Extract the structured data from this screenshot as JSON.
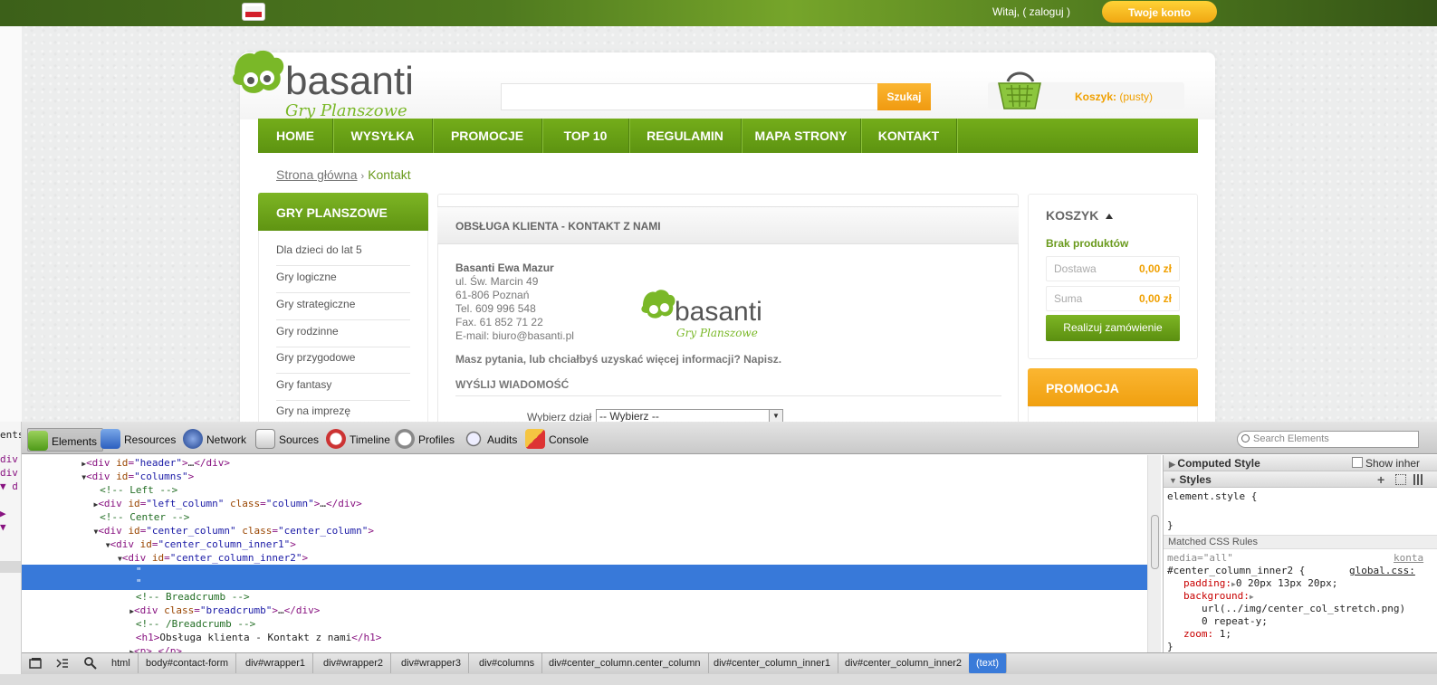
{
  "site": {
    "welcome": "Witaj, ( zaloguj )",
    "account_button": "Twoje konto",
    "logo_text": "basanti",
    "logo_tagline": "Gry Planszowe",
    "search_button": "Szukaj",
    "cart_label": "Koszyk:",
    "cart_status": "(pusty)",
    "nav": [
      "HOME",
      "WYSYŁKA",
      "PROMOCJE",
      "TOP 10",
      "REGULAMIN",
      "MAPA STRONY",
      "KONTAKT"
    ],
    "breadcrumb": {
      "home": "Strona główna",
      "sep": "›",
      "current": "Kontakt"
    },
    "categories_title": "GRY PLANSZOWE",
    "categories": [
      "Dla dzieci do lat 5",
      "Gry logiczne",
      "Gry strategiczne",
      "Gry rodzinne",
      "Gry przygodowe",
      "Gry fantasy",
      "Gry na imprezę"
    ],
    "center_title": "OBSŁUGA KLIENTA - KONTAKT Z NAMI",
    "address": {
      "name": "Basanti Ewa Mazur",
      "street": "ul. Św. Marcin 49",
      "city": "61-806 Poznań",
      "tel": "Tel. 609 996 548",
      "fax": "Fax. 61 852 71 22",
      "email": "E-mail: biuro@basanti.pl"
    },
    "question": "Masz pytania, lub chciałbyś uzyskać więcej informacji? Napisz.",
    "send_title": "WYŚLIJ WIADOMOŚĆ",
    "dept_label": "Wybierz dział",
    "dept_selected": "-- Wybierz --",
    "cart_box": {
      "title": "KOSZYK",
      "empty": "Brak produktów",
      "shipping_label": "Dostawa",
      "shipping_value": "0,00 zł",
      "sum_label": "Suma",
      "sum_value": "0,00 zł",
      "checkout": "Realizuj zamówienie"
    },
    "promo_title": "PROMOCJA"
  },
  "devtools": {
    "tabs": [
      "Elements",
      "Resources",
      "Network",
      "Sources",
      "Timeline",
      "Profiles",
      "Audits",
      "Console"
    ],
    "search_placeholder": "Search Elements",
    "left_strip": [
      "ents",
      "div i",
      "div",
      "▼ d",
      "",
      "▶",
      "▼",
      "",
      "",
      "",
      "",
      "",
      "",
      "",
      ""
    ],
    "sidebar": {
      "computed_style": "Computed Style",
      "show_inherited": "Show inher",
      "styles": "Styles",
      "element_style": "element.style {",
      "close_brace": "}",
      "matched": "Matched CSS Rules",
      "media": "media=\"all\"",
      "source_file": "konta",
      "selector": "#center_column_inner2 {",
      "source_link": "global.css:",
      "padding_prop": "padding:",
      "padding_val": "0 20px 13px 20px;",
      "background_prop": "background:",
      "background_url": "url(../img/center_col_stretch.png)",
      "background_rest": "0 repeat-y;",
      "zoom_prop": "zoom:",
      "zoom_val": "1;",
      "end_brace": "}"
    },
    "breadcrumbs": [
      "html",
      "body#contact-form",
      "div#wrapper1",
      "div#wrapper2",
      "div#wrapper3",
      "div#columns",
      "div#center_column.center_column",
      "div#center_column_inner1",
      "div#center_column_inner2",
      "(text)"
    ]
  }
}
